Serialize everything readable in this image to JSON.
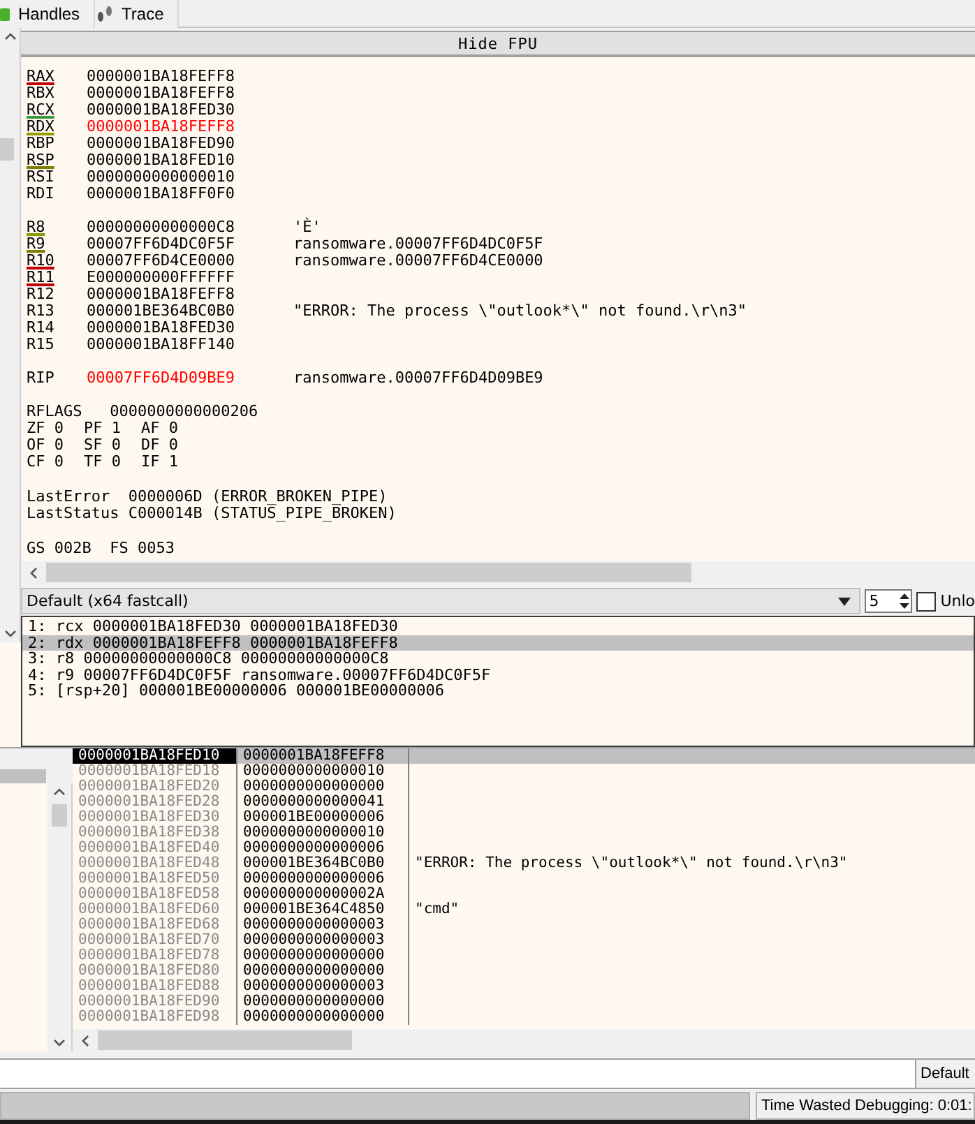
{
  "tabs": [
    {
      "label": "Handles",
      "selected": false
    },
    {
      "label": "Trace",
      "selected": false
    }
  ],
  "fpu_button": "Hide FPU",
  "register_groups": [
    [
      {
        "name": "RAX",
        "value": "0000001BA18FEFF8",
        "changed": false,
        "color": "#c00000"
      },
      {
        "name": "RBX",
        "value": "0000001BA18FEFF8",
        "changed": false
      },
      {
        "name": "RCX",
        "value": "0000001BA18FED30",
        "changed": false,
        "color": "#3a9a3a"
      },
      {
        "name": "RDX",
        "value": "0000001BA18FEFF8",
        "changed": true,
        "color": "#9a9a00"
      },
      {
        "name": "RBP",
        "value": "0000001BA18FED90",
        "changed": false
      },
      {
        "name": "RSP",
        "value": "0000001BA18FED10",
        "changed": false,
        "color": "#808000"
      },
      {
        "name": "RSI",
        "value": "0000000000000010",
        "changed": false
      },
      {
        "name": "RDI",
        "value": "0000001BA18FF0F0",
        "changed": false
      }
    ],
    [
      {
        "name": "R8",
        "value": "00000000000000C8",
        "comment": "'È'",
        "changed": false,
        "color": "#8a9a00"
      },
      {
        "name": "R9",
        "value": "00007FF6D4DC0F5F",
        "comment": "ransomware.00007FF6D4DC0F5F",
        "changed": false,
        "color": "#808000"
      },
      {
        "name": "R10",
        "value": "00007FF6D4CE0000",
        "comment": "ransomware.00007FF6D4CE0000",
        "changed": false,
        "color": "#c00000"
      },
      {
        "name": "R11",
        "value": "E000000000FFFFFF",
        "changed": false,
        "color": "#c00000"
      },
      {
        "name": "R12",
        "value": "0000001BA18FEFF8",
        "changed": false
      },
      {
        "name": "R13",
        "value": "000001BE364BC0B0",
        "comment": "\"ERROR: The process \\\"outlook*\\\" not found.\\r\\n3\"",
        "changed": false
      },
      {
        "name": "R14",
        "value": "0000001BA18FED30",
        "changed": false
      },
      {
        "name": "R15",
        "value": "0000001BA18FF140",
        "changed": false
      }
    ],
    [
      {
        "name": "RIP",
        "value": "00007FF6D4D09BE9",
        "comment": "ransomware.00007FF6D4D09BE9",
        "changed": true
      }
    ]
  ],
  "rflags": {
    "name": "RFLAGS",
    "value": "0000000000000206"
  },
  "flags": [
    [
      "ZF 0",
      "PF 1",
      "AF 0"
    ],
    [
      "OF 0",
      "SF 0",
      "DF 0"
    ],
    [
      "CF 0",
      "TF 0",
      "IF 1"
    ]
  ],
  "errors": [
    "LastError  0000006D (ERROR_BROKEN_PIPE)",
    "LastStatus C000014B (STATUS_PIPE_BROKEN)"
  ],
  "segments": [
    "GS 002B  FS 0053"
  ],
  "calling_convention": {
    "value": "Default (x64 fastcall)",
    "count": "5",
    "unlock_label": "Unlo",
    "unlock_checked": false
  },
  "args": [
    {
      "text": "1: rcx 0000001BA18FED30 0000001BA18FED30",
      "selected": false
    },
    {
      "text": "2: rdx 0000001BA18FEFF8 0000001BA18FEFF8",
      "selected": true
    },
    {
      "text": "3: r8 00000000000000C8 00000000000000C8",
      "selected": false
    },
    {
      "text": "4: r9 00007FF6D4DC0F5F ransomware.00007FF6D4DC0F5F",
      "selected": false
    },
    {
      "text": "5: [rsp+20] 000001BE00000006 000001BE00000006",
      "selected": false
    }
  ],
  "stack": [
    {
      "address": "0000001BA18FED10",
      "value": "0000001BA18FEFF8",
      "selected": true
    },
    {
      "address": "0000001BA18FED18",
      "value": "0000000000000010",
      "selected": false
    },
    {
      "address": "0000001BA18FED20",
      "value": "0000000000000000",
      "selected": false
    },
    {
      "address": "0000001BA18FED28",
      "value": "0000000000000041",
      "selected": false
    },
    {
      "address": "0000001BA18FED30",
      "value": "000001BE00000006",
      "selected": false
    },
    {
      "address": "0000001BA18FED38",
      "value": "0000000000000010",
      "selected": false
    },
    {
      "address": "0000001BA18FED40",
      "value": "0000000000000006",
      "selected": false
    },
    {
      "address": "0000001BA18FED48",
      "value": "000001BE364BC0B0",
      "comment": "\"ERROR: The process \\\"outlook*\\\" not found.\\r\\n3\"",
      "selected": false
    },
    {
      "address": "0000001BA18FED50",
      "value": "0000000000000006",
      "selected": false
    },
    {
      "address": "0000001BA18FED58",
      "value": "000000000000002A",
      "selected": false
    },
    {
      "address": "0000001BA18FED60",
      "value": "000001BE364C4850",
      "comment": "\"cmd\"",
      "selected": false
    },
    {
      "address": "0000001BA18FED68",
      "value": "0000000000000003",
      "selected": false
    },
    {
      "address": "0000001BA18FED70",
      "value": "0000000000000003",
      "selected": false
    },
    {
      "address": "0000001BA18FED78",
      "value": "0000000000000000",
      "selected": false
    },
    {
      "address": "0000001BA18FED80",
      "value": "0000000000000000",
      "selected": false
    },
    {
      "address": "0000001BA18FED88",
      "value": "0000000000000003",
      "selected": false
    },
    {
      "address": "0000001BA18FED90",
      "value": "0000000000000000",
      "selected": false
    },
    {
      "address": "0000001BA18FED98",
      "value": "0000000000000000",
      "selected": false
    }
  ],
  "command_mode": "Default",
  "status": "Time Wasted Debugging: 0:01:"
}
